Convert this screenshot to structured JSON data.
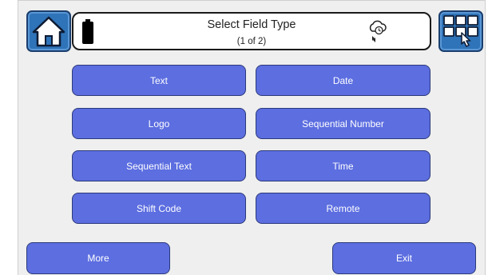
{
  "header": {
    "title": "Select Field Type",
    "page_indicator": "(1 of 2)",
    "home_icon": "home-icon",
    "battery_icon": "battery-icon",
    "status_icon": "cloud-sync-icon",
    "menu_icon": "grid-menu-icon"
  },
  "field_types": [
    "Text",
    "Date",
    "Logo",
    "Sequential Number",
    "Sequential Text",
    "Time",
    "Shift Code",
    "Remote"
  ],
  "footer": {
    "more_label": "More",
    "exit_label": "Exit"
  },
  "colors": {
    "button_fill": "#5c6ee0",
    "header_button": "#2f73b8",
    "background": "#efefef"
  }
}
